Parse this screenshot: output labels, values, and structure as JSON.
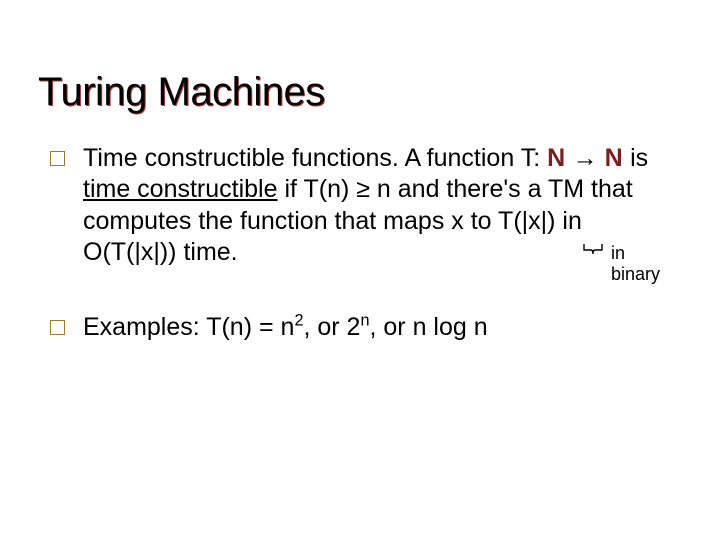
{
  "title": "Turing Machines",
  "bullets": [
    {
      "lead": "Time constructible functions.",
      "rest1": "  A function T:  ",
      "nat1": "N",
      "arrow": "→",
      "nat2": "N",
      "rest2": " is ",
      "under": "time constructible",
      "rest3": " if T(n) ≥ n and there's a TM that computes the function that maps x to T(|x|) in O(T(|x|)) time."
    },
    {
      "text1": "Examples:  T(n) = n",
      "sup1": "2",
      "text2": ", or 2",
      "sup2": "n",
      "text3": ", or n log n"
    }
  ],
  "note": {
    "l1": "in",
    "l2": "binary"
  }
}
